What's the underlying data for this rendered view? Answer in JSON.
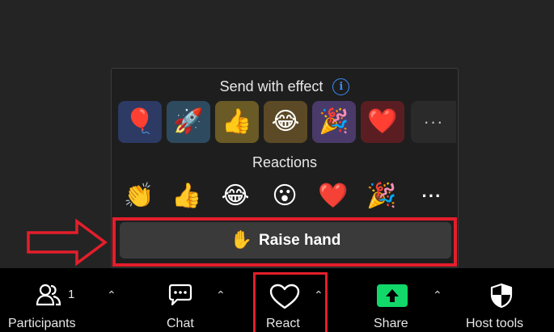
{
  "popup": {
    "effect_title": "Send with effect",
    "effects": [
      {
        "icon": "balloon-icon",
        "glyph": "🎈",
        "bg": "#2c3a64"
      },
      {
        "icon": "rocket-icon",
        "glyph": "🚀",
        "bg": "#2e4a5e"
      },
      {
        "icon": "thumbs-up-icon",
        "glyph": "👍",
        "bg": "#6a5a26"
      },
      {
        "icon": "laughing-icon",
        "glyph": "😂",
        "bg": "#5c4a26"
      },
      {
        "icon": "party-popper-icon",
        "glyph": "🎉",
        "bg": "#4a3a6a"
      },
      {
        "icon": "heart-icon",
        "glyph": "❤️",
        "bg": "#5a1e22"
      }
    ],
    "effect_more_glyph": "···",
    "reactions_title": "Reactions",
    "reactions": [
      {
        "icon": "clap-icon",
        "glyph": "👏"
      },
      {
        "icon": "thumbs-up-icon",
        "glyph": "👍"
      },
      {
        "icon": "laughing-icon",
        "glyph": "😂"
      },
      {
        "icon": "surprised-icon",
        "glyph": "😮"
      },
      {
        "icon": "heart-icon",
        "glyph": "❤️"
      },
      {
        "icon": "party-popper-icon",
        "glyph": "🎉"
      }
    ],
    "reaction_more_glyph": "···",
    "raise_hand_glyph": "✋",
    "raise_hand_label": "Raise hand"
  },
  "toolbar": {
    "participants_label": "Participants",
    "participants_count": "1",
    "chat_label": "Chat",
    "react_label": "React",
    "share_label": "Share",
    "host_tools_label": "Host tools",
    "caret_glyph": "⌃"
  },
  "colors": {
    "highlight": "#e41e2b",
    "share_green": "#12d86a",
    "info_blue": "#3a8ef6",
    "toolbar_bg": "#000000",
    "page_bg": "#242424"
  }
}
